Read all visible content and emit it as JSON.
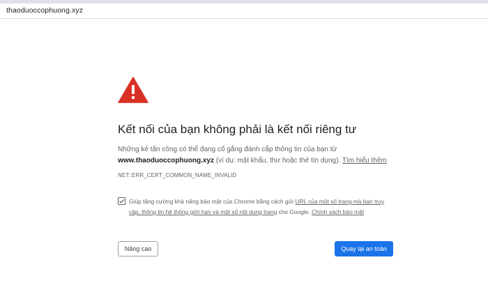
{
  "browser": {
    "url": "thaoduoccophuong.xyz"
  },
  "interstitial": {
    "heading": "Kết nối của bạn không phải là kết nối riêng tư",
    "message_part1": "Những kẻ tấn công có thể đang cố gắng đánh cắp thông tin của bạn từ",
    "domain": "www.thaoduoccophuong.xyz",
    "message_part2": "(ví dụ: mật khẩu, thư hoặc thẻ tín dụng).",
    "learn_more": "Tìm hiểu thêm",
    "error_code": "NET::ERR_CERT_COMMON_NAME_INVALID",
    "opt_in": {
      "checked": true,
      "text_before": "Giúp tăng cường khả năng bảo mật của Chrome bằng cách gửi",
      "link1": "URL của một số trang mà bạn truy cập, thông tin hệ thống giới hạn và một số nội dung trang",
      "text_middle": "cho Google.",
      "link2": "Chính sách bảo mật"
    },
    "advanced_label": "Nâng cao",
    "back_to_safety_label": "Quay lại an toàn"
  },
  "colors": {
    "warning": "#d93025",
    "primary_button": "#1a73e8",
    "text_secondary": "#5f6368"
  },
  "icons": {
    "warning": "warning-triangle-icon",
    "checkbox": "checkmark-icon"
  }
}
